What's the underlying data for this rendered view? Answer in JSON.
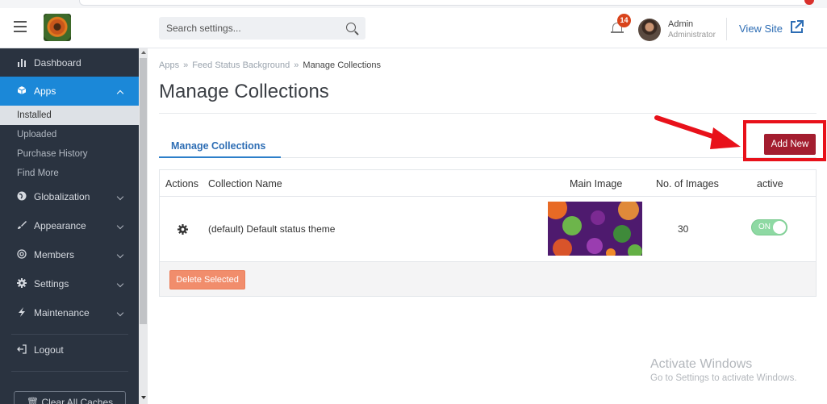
{
  "header": {
    "search_placeholder": "Search settings...",
    "notification_count": "14",
    "user_name": "Admin",
    "user_role": "Administrator",
    "view_site_label": "View Site"
  },
  "sidebar": {
    "items": [
      {
        "label": "Dashboard",
        "icon": "bar-chart-icon"
      },
      {
        "label": "Apps",
        "icon": "box-icon",
        "active": true
      },
      {
        "label": "Globalization",
        "icon": "globe-icon"
      },
      {
        "label": "Appearance",
        "icon": "brush-icon"
      },
      {
        "label": "Members",
        "icon": "at-icon"
      },
      {
        "label": "Settings",
        "icon": "gear-icon"
      },
      {
        "label": "Maintenance",
        "icon": "bolt-icon"
      },
      {
        "label": "Logout",
        "icon": "logout-icon"
      }
    ],
    "apps_sub": [
      "Installed",
      "Uploaded",
      "Purchase History",
      "Find More"
    ],
    "clear_caches_label": "Clear All Caches"
  },
  "breadcrumb": {
    "items": [
      "Apps",
      "Feed Status Background",
      "Manage Collections"
    ],
    "separator": "»"
  },
  "page": {
    "title": "Manage Collections",
    "tab_label": "Manage Collections",
    "add_new_label": "Add New"
  },
  "table": {
    "headers": [
      "Actions",
      "Collection Name",
      "Main Image",
      "No. of Images",
      "active"
    ],
    "rows": [
      {
        "name": "(default) Default status theme",
        "images": "30",
        "active_label": "ON"
      }
    ],
    "delete_selected_label": "Delete Selected"
  },
  "watermark": {
    "title": "Activate Windows",
    "subtitle": "Go to Settings to activate Windows."
  },
  "colors": {
    "sidebar_bg": "#2a3340",
    "sidebar_active": "#1b88d8",
    "link_blue": "#2d6db4",
    "add_new_bg": "#a31d2f",
    "highlight_red": "#e8111a",
    "delete_bg": "#f18d6c",
    "toggle_on": "#8ed9a3"
  }
}
